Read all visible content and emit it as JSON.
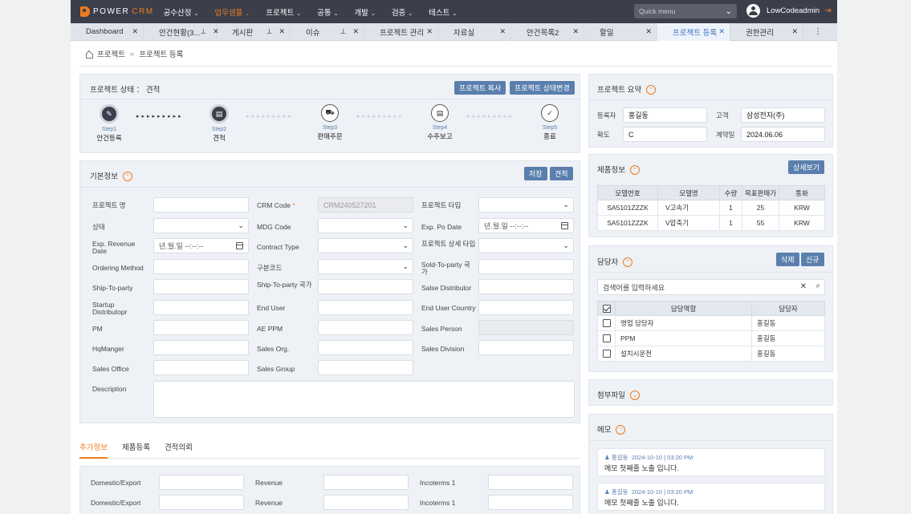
{
  "header": {
    "logo_power": "POWER",
    "logo_crm": "CRM",
    "menu": [
      "공수산정",
      "업무샘플",
      "프로젝트",
      "공통",
      "개발",
      "검증",
      "테스트"
    ],
    "quick_placeholder": "Quick menu",
    "user": "LowCodeadmin"
  },
  "tabs": [
    {
      "label": "Dashboard"
    },
    {
      "label": "안건현황(3..."
    },
    {
      "label": "게시판"
    },
    {
      "label": "이슈"
    },
    {
      "label": "프로젝트 관리"
    },
    {
      "label": "자료실"
    },
    {
      "label": "안건목록2"
    },
    {
      "label": "할일"
    },
    {
      "label": "프로젝트 등록"
    },
    {
      "label": "권한관리"
    }
  ],
  "breadcrumb": {
    "root": "프로젝트",
    "current": "프로젝트 등록"
  },
  "status": {
    "label": "프로젝트 상태",
    "value": "견적",
    "copy_btn": "프로젝트 복사",
    "change_btn": "프로젝트 상태변경",
    "steps": [
      {
        "num": "Step1",
        "label": "안건등록"
      },
      {
        "num": "Step2",
        "label": "견적"
      },
      {
        "num": "Step3",
        "label": "판매주문"
      },
      {
        "num": "Step4",
        "label": "수주보고"
      },
      {
        "num": "Step5",
        "label": "종료"
      }
    ]
  },
  "basic": {
    "title": "기본정보",
    "save_btn": "저장",
    "quote_btn": "견적",
    "labels": {
      "name": "프로젝트 명",
      "crm_code": "CRM Code",
      "type": "프로젝트 타입",
      "state": "상태",
      "mdg": "MDG Code",
      "po_date": "Exp. Po Date",
      "rev_date": "Exp. Revenue Date",
      "contract": "Contract Type",
      "detail_type": "프로젝트 상세 타입",
      "ordering": "Ordering Method",
      "gubun": "구분코드",
      "sold_country": "Sold-To-party 국가",
      "ship": "Ship-To-party",
      "ship_country": "Ship-To-party 국가",
      "distributor": "Salse Distributor",
      "startup": "Startup Distributopr",
      "end_user": "End User",
      "end_country": "End User Country",
      "pm": "PM",
      "ae_ppm": "AE PPM",
      "sales_person": "Sales Person",
      "hq": "HqManger",
      "sales_org": "Sales Org.",
      "sales_div": "Sales Division",
      "sales_office": "Sales Office",
      "sales_group": "Sales Group",
      "desc": "Description"
    },
    "crm_code_value": "CRM240527201",
    "date_placeholder": "년.월.일 --:--:--",
    "date_placeholder2": "년.월.일 --:--:--",
    "required_mark": "*"
  },
  "subtabs": [
    "추가정보",
    "제품등록",
    "견적의뢰"
  ],
  "extra": {
    "labels": [
      "Domestic/Export",
      "Revenue",
      "Incoterms 1"
    ]
  },
  "summary": {
    "title": "프로젝트 요약",
    "reg_label": "등록자",
    "reg": "홍길동",
    "customer_label": "고객",
    "customer": "삼성전자(주)",
    "prob_label": "확도",
    "prob": "C",
    "contract_label": "계약일",
    "contract": "2024.06.06"
  },
  "products": {
    "title": "제품정보",
    "detail_btn": "상세보기",
    "headers": [
      "모델번호",
      "모델명",
      "수량",
      "목표판매가",
      "통화"
    ],
    "rows": [
      [
        "SA5101ZZZK",
        "V고속기",
        "1",
        "25",
        "KRW"
      ],
      [
        "SA5101ZZZK",
        "V압축기",
        "1",
        "55",
        "KRW"
      ]
    ]
  },
  "managers": {
    "title": "담당자",
    "del_btn": "삭제",
    "new_btn": "신규",
    "search_placeholder": "검색어를 입력하세요",
    "headers": [
      "담당역할",
      "담당자"
    ],
    "rows": [
      [
        "영업 담당자",
        "홍길동"
      ],
      [
        "PPM",
        "홍길동"
      ],
      [
        "설치시운전",
        "홍길동"
      ]
    ]
  },
  "attach": {
    "title": "첨부파일"
  },
  "memo": {
    "title": "메모",
    "items": [
      {
        "author": "홍길동",
        "date": "2024-10-10 | 03:20 PM",
        "text": "메모 첫째줄 노출 입니다."
      },
      {
        "author": "홍길동",
        "date": "2024-10-10 | 03:20 PM",
        "text": "메모 첫째줄 노출 입니다."
      }
    ]
  },
  "colors": {
    "accent": "#f07b1d",
    "primary": "#5a7fad",
    "topbar": "#3a3f4b"
  }
}
